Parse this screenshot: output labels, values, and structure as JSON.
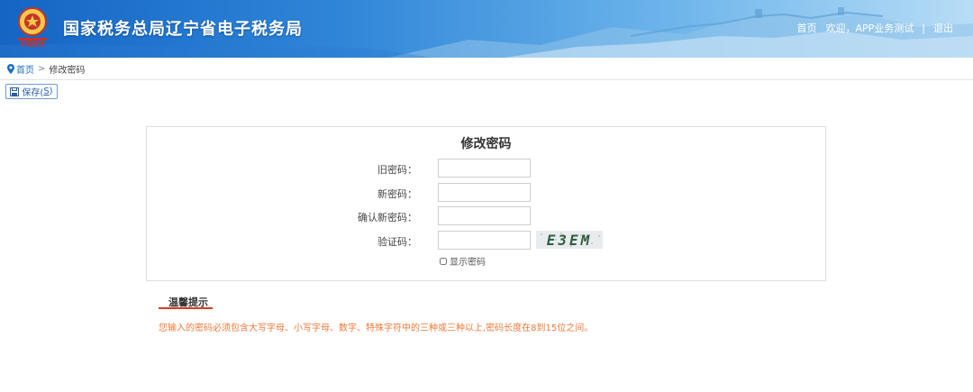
{
  "header": {
    "site_title": "国家税务总局辽宁省电子税务局",
    "emblem_text": "中国税务",
    "nav": {
      "home": "首页",
      "welcome": "欢迎，APP业务测试",
      "separator": "|",
      "logout": "退出"
    },
    "colors": {
      "sky_dark": "#1565c4",
      "sky_light": "#b8ddf6"
    }
  },
  "breadcrumb": {
    "icon": "location-pin-icon",
    "home": "首页",
    "separator": ">",
    "current": "修改密码"
  },
  "toolbar": {
    "save_label": "保存(",
    "save_hotkey": "S",
    "save_suffix": ")",
    "save_icon": "save-icon"
  },
  "form": {
    "title": "修改密码",
    "fields": [
      {
        "label": "旧密码：",
        "value": "",
        "type": "password"
      },
      {
        "label": "新密码：",
        "value": "",
        "type": "password"
      },
      {
        "label": "确认新密码：",
        "value": "",
        "type": "password"
      },
      {
        "label": "验证码：",
        "value": "",
        "type": "text"
      }
    ],
    "captcha_text": "E3EM",
    "show_password_label": "显示密码",
    "show_password_checked": false
  },
  "tips": {
    "title": "温馨提示",
    "text": "您输入的密码必须包含大写字母、小写字母、数字、特殊字符中的三种或三种以上,密码长度在8到15位之间。",
    "accent_color": "#e03a1e",
    "text_color": "#ee7a3a"
  }
}
